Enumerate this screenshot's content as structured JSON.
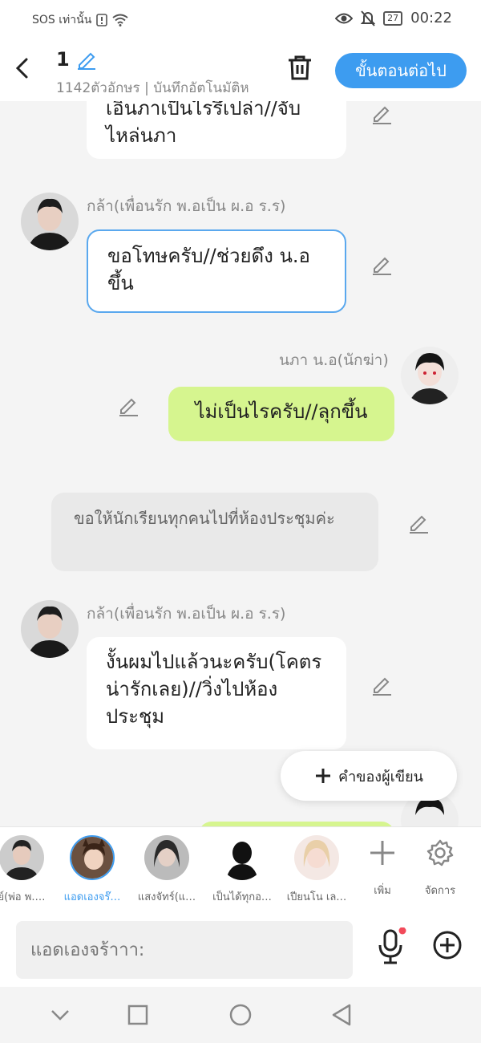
{
  "status": {
    "left": "SOS เท่านั้น",
    "battery": "27",
    "time": "00:22"
  },
  "header": {
    "title": "1",
    "subtitle": "1142ตัวอักษร | บันทึกอัตโนมัติห",
    "next_label": "ขั้นตอนต่อไป"
  },
  "messages": {
    "m0": {
      "text": "เอินภาเป็นไรรึเปล่า//จับไหล่นภา"
    },
    "m1": {
      "name": "กล้า(เพื่อนรัก พ.อเป็น ผ.อ ร.ร)",
      "text": "ขอโทษครับ//ช่วยดึง น.อขึ้น"
    },
    "m2": {
      "name": "นภา น.อ(นักฆ่า)",
      "text": "ไม่เป็นไรครับ//ลุกขึ้น"
    },
    "m3": {
      "text": "ขอให้นักเรียนทุกคนไปที่ห้องประชุมค่ะ"
    },
    "m4": {
      "name": "กล้า(เพื่อนรัก พ.อเป็น ผ.อ ร.ร)",
      "text": "งั้นผมไปแล้วนะครับ(โคตรน่ารักเลย)//วิ่งไปห้องประชุม"
    }
  },
  "fab": {
    "label": "คำของผู้เขียน"
  },
  "characters": [
    {
      "label": "ย์(พ่อ พ.…"
    },
    {
      "label": "แอดเองจร๊…"
    },
    {
      "label": "แสงจัทร์(แ…"
    },
    {
      "label": "เป็นได้ทุกอ…"
    },
    {
      "label": "เปียนโน เล…"
    }
  ],
  "tools": {
    "add": "เพิ่ม",
    "manage": "จัดการ"
  },
  "input": {
    "placeholder": "แอดเองจร้าาา:"
  }
}
